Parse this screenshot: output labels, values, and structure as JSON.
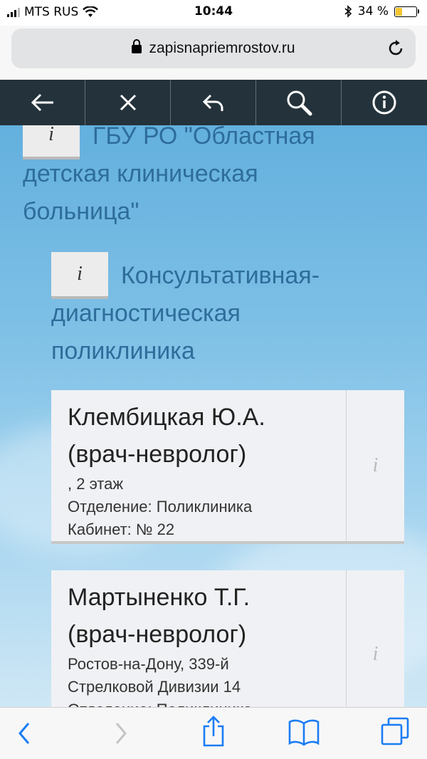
{
  "status_bar": {
    "carrier": "MTS RUS",
    "time": "10:44",
    "battery": "34 %",
    "battery_level": 0.34
  },
  "browser": {
    "url": "zapisnapriemrostov.ru"
  },
  "toolbar": {
    "buttons": [
      "back-arrow-icon",
      "close-icon",
      "reply-icon",
      "search-icon",
      "info-icon"
    ]
  },
  "main": {
    "hospital": {
      "info_label": "i",
      "title": "ГБУ РО \"Областная детская клиническая больница\""
    },
    "department": {
      "info_label": "i",
      "title": "Консультативная-диагностическая поликлиника"
    },
    "doctors": [
      {
        "name": "Клембицкая Ю.А.",
        "specialty": "(врач-невролог)",
        "lines": [
          ", 2 этаж",
          "Отделение: Поликлиника",
          "Кабинет: № 22"
        ],
        "info_label": "i"
      },
      {
        "name": "Мартыненко Т.Г.",
        "specialty": "(врач-невролог)",
        "lines": [
          "Ростов-на-Дону, 339-й",
          "Стрелковой Дивизии 14",
          "Отделение: Поликлиника"
        ],
        "info_label": "i"
      }
    ]
  },
  "colors": {
    "toolbar_bg": "#24333b",
    "heading": "#2e6d9b",
    "ios_blue": "#1a7cf5"
  }
}
